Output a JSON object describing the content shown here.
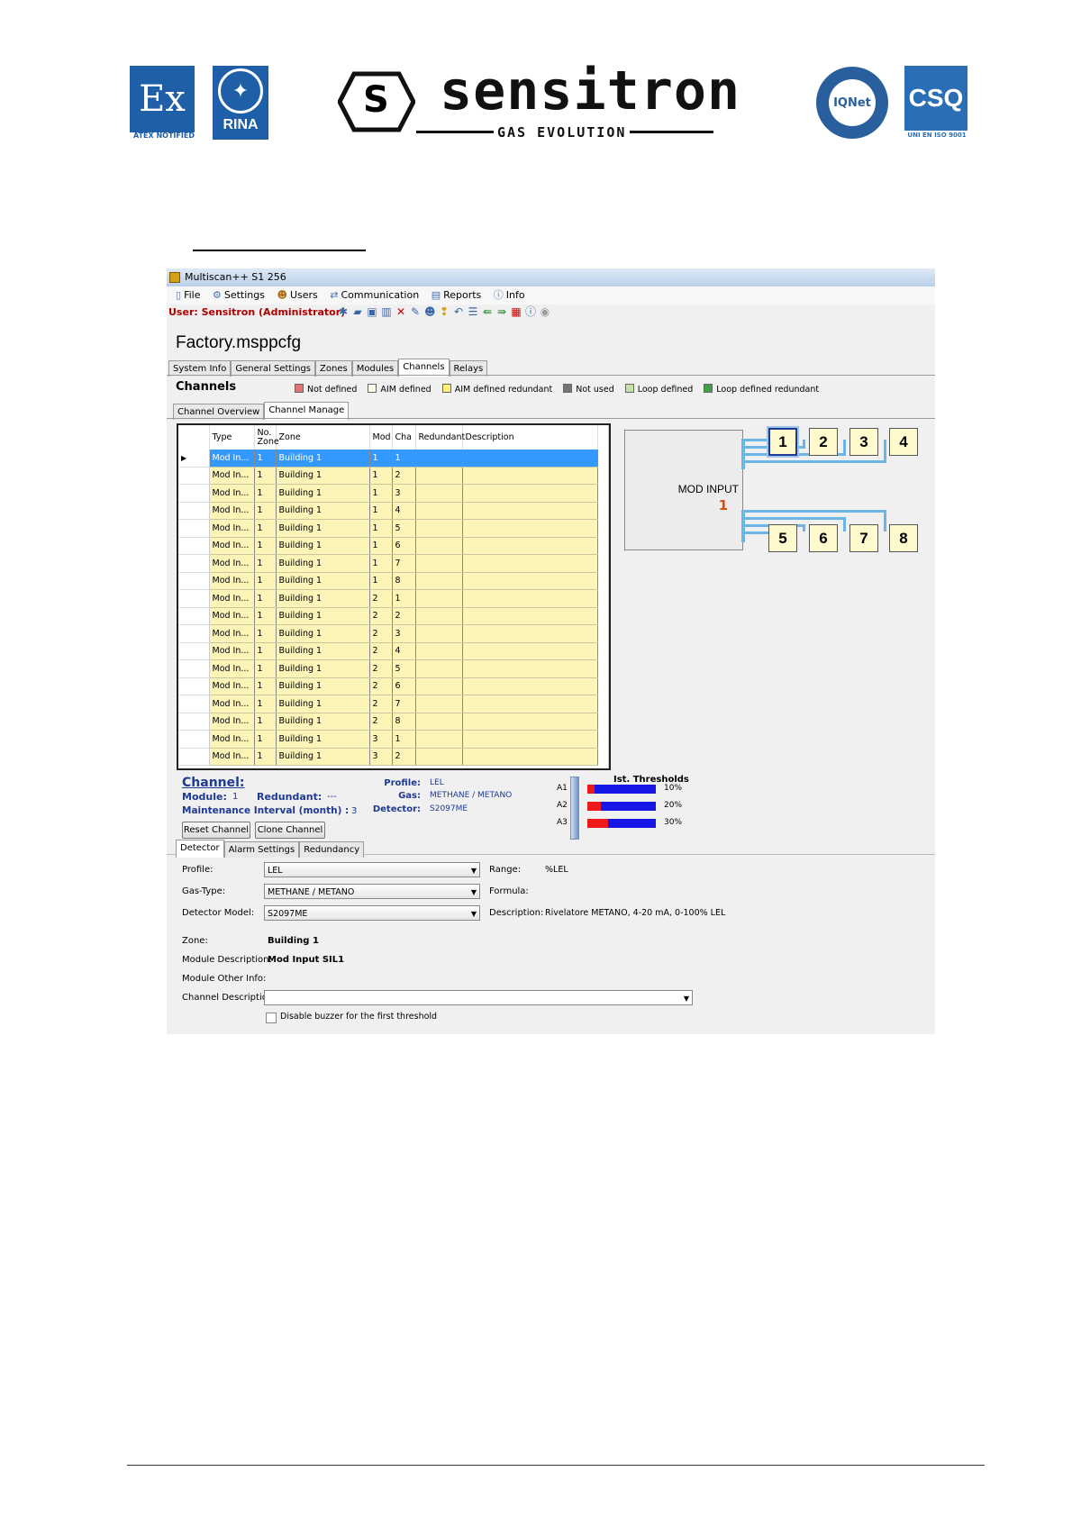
{
  "header": {
    "ex_glyph": "Ex",
    "ex_caption": "ATEX NOTIFIED",
    "rina_label": "RINA",
    "brand_initial": "S",
    "brand_name": "sensitron",
    "brand_tagline": "GAS EVOLUTION",
    "iqnet_label": "IQNet",
    "csq_label": "CSQ",
    "csq_caption": "UNI EN ISO 9001"
  },
  "window": {
    "title": "Multiscan++ S1 256",
    "menu": [
      {
        "icon": "file-icon",
        "label": "File"
      },
      {
        "icon": "gear-icon",
        "label": "Settings"
      },
      {
        "icon": "users-icon",
        "label": "Users"
      },
      {
        "icon": "communication-icon",
        "label": "Communication"
      },
      {
        "icon": "printer-icon",
        "label": "Reports"
      },
      {
        "icon": "info-icon",
        "label": "Info"
      }
    ],
    "user_line": "User: Sensitron  (Administrator)",
    "file_title": "Factory.msppcfg",
    "main_tabs": [
      "System Info",
      "General Settings",
      "Zones",
      "Modules",
      "Channels",
      "Relays"
    ],
    "active_main_tab": "Channels",
    "section_title": "Channels",
    "legend": [
      {
        "label": "Not defined",
        "color": "#e57373"
      },
      {
        "label": "AIM defined",
        "color": "#fffde7"
      },
      {
        "label": "AIM defined redundant",
        "color": "#fff176"
      },
      {
        "label": "Not used",
        "color": "#757575"
      },
      {
        "label": "Loop defined",
        "color": "#c5e1a5"
      },
      {
        "label": "Loop defined redundant",
        "color": "#43a047"
      }
    ],
    "sub_tabs": [
      "Channel Overview",
      "Channel Manage"
    ],
    "active_sub_tab": "Channel Manage"
  },
  "grid": {
    "headers": [
      "Type",
      "No. Zone",
      "Zone",
      "Mod",
      "Cha",
      "Redundant",
      "Description"
    ],
    "rows": [
      [
        "Mod In...",
        "1",
        "Building 1",
        "1",
        "1",
        "",
        ""
      ],
      [
        "Mod In...",
        "1",
        "Building 1",
        "1",
        "2",
        "",
        ""
      ],
      [
        "Mod In...",
        "1",
        "Building 1",
        "1",
        "3",
        "",
        ""
      ],
      [
        "Mod In...",
        "1",
        "Building 1",
        "1",
        "4",
        "",
        ""
      ],
      [
        "Mod In...",
        "1",
        "Building 1",
        "1",
        "5",
        "",
        ""
      ],
      [
        "Mod In...",
        "1",
        "Building 1",
        "1",
        "6",
        "",
        ""
      ],
      [
        "Mod In...",
        "1",
        "Building 1",
        "1",
        "7",
        "",
        ""
      ],
      [
        "Mod In...",
        "1",
        "Building 1",
        "1",
        "8",
        "",
        ""
      ],
      [
        "Mod In...",
        "1",
        "Building 1",
        "2",
        "1",
        "",
        ""
      ],
      [
        "Mod In...",
        "1",
        "Building 1",
        "2",
        "2",
        "",
        ""
      ],
      [
        "Mod In...",
        "1",
        "Building 1",
        "2",
        "3",
        "",
        ""
      ],
      [
        "Mod In...",
        "1",
        "Building 1",
        "2",
        "4",
        "",
        ""
      ],
      [
        "Mod In...",
        "1",
        "Building 1",
        "2",
        "5",
        "",
        ""
      ],
      [
        "Mod In...",
        "1",
        "Building 1",
        "2",
        "6",
        "",
        ""
      ],
      [
        "Mod In...",
        "1",
        "Building 1",
        "2",
        "7",
        "",
        ""
      ],
      [
        "Mod In...",
        "1",
        "Building 1",
        "2",
        "8",
        "",
        ""
      ],
      [
        "Mod In...",
        "1",
        "Building 1",
        "3",
        "1",
        "",
        ""
      ],
      [
        "Mod In...",
        "1",
        "Building 1",
        "3",
        "2",
        "",
        ""
      ]
    ]
  },
  "module": {
    "label": "MOD INPUT",
    "number": "1",
    "channels_top": [
      "1",
      "2",
      "3",
      "4"
    ],
    "channels_bottom": [
      "5",
      "6",
      "7",
      "8"
    ],
    "selected_channel": "1"
  },
  "channel": {
    "title": "Channel:",
    "module_label": "Module:",
    "module_value": "1",
    "redundant_label": "Redundant:",
    "redundant_value": "---",
    "maint_label": "Maintenance Interval (month) :",
    "maint_value": "3",
    "profile_label": "Profile:",
    "profile_value": "LEL",
    "gas_label": "Gas:",
    "gas_value": "METHANE / METANO",
    "detector_label": "Detector:",
    "detector_value": "S2097ME",
    "reset_button": "Reset Channel",
    "clone_button": "Clone Channel",
    "thresholds_title": "Ist. Thresholds",
    "thresholds": [
      {
        "name": "A1",
        "percent_label": "10%",
        "level": 0.1
      },
      {
        "name": "A2",
        "percent_label": "20%",
        "level": 0.2
      },
      {
        "name": "A3",
        "percent_label": "30%",
        "level": 0.3
      }
    ]
  },
  "detector": {
    "tabs": [
      "Detector",
      "Alarm Settings",
      "Redundancy"
    ],
    "active_tab": "Detector",
    "profile_label": "Profile:",
    "profile_value": "LEL",
    "gas_type_label": "Gas-Type:",
    "gas_type_value": "METHANE / METANO",
    "model_label": "Detector Model:",
    "model_value": "S2097ME",
    "range_label": "Range:",
    "range_value": "%LEL",
    "formula_label": "Formula:",
    "formula_value": "",
    "description_label": "Description:",
    "description_value": "Rivelatore METANO, 4-20 mA, 0-100% LEL",
    "zone_label": "Zone:",
    "zone_value": "Building 1",
    "module_desc_label": "Module Description:",
    "module_desc_value": "Mod Input SIL1",
    "module_other_label": "Module Other Info:",
    "module_other_value": "",
    "channel_desc_label": "Channel Description:",
    "channel_desc_value": "",
    "buzzer_label": "Disable buzzer for the first threshold",
    "buzzer_checked": false
  }
}
